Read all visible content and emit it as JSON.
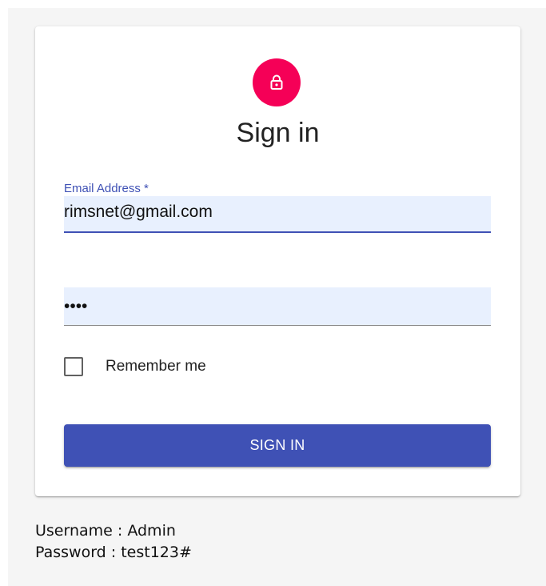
{
  "card": {
    "title": "Sign in",
    "icon": "lock-icon",
    "accent_color": "#f50057"
  },
  "email": {
    "label": "Email Address *",
    "value": "rimsnet@gmail.com"
  },
  "password": {
    "value": "••••",
    "type": "password"
  },
  "remember": {
    "label": "Remember me",
    "checked": false
  },
  "signin_button": {
    "label": "SIGN IN",
    "color": "#3f51b5"
  },
  "credentials": {
    "username_line": "Username : Admin",
    "password_line": "Password : test123#"
  }
}
